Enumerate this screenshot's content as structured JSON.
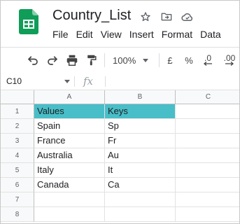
{
  "app": {
    "doc_title": "Country_List",
    "menu": [
      "File",
      "Edit",
      "View",
      "Insert",
      "Format",
      "Data"
    ]
  },
  "toolbar": {
    "zoom": "100%",
    "currency": "£",
    "percent": "%",
    "decrease_decimals": ".0",
    "increase_decimals": ".00"
  },
  "formula_bar": {
    "name_box": "C10",
    "fx_label": "fx",
    "value": ""
  },
  "grid": {
    "columns": [
      "A",
      "B",
      "C"
    ],
    "rows": [
      {
        "num": "1",
        "cells": [
          "Values",
          "Keys",
          ""
        ]
      },
      {
        "num": "2",
        "cells": [
          "Spain",
          "Sp",
          ""
        ]
      },
      {
        "num": "3",
        "cells": [
          "France",
          "Fr",
          ""
        ]
      },
      {
        "num": "4",
        "cells": [
          "Australia",
          "Au",
          ""
        ]
      },
      {
        "num": "5",
        "cells": [
          "Italy",
          "It",
          ""
        ]
      },
      {
        "num": "6",
        "cells": [
          "Canada",
          "Ca",
          ""
        ]
      },
      {
        "num": "7",
        "cells": [
          "",
          "",
          ""
        ]
      },
      {
        "num": "8",
        "cells": [
          "",
          "",
          ""
        ]
      }
    ],
    "header_fill": "#48bec8"
  },
  "colors": {
    "sheets_green": "#0f9d58",
    "gridline": "#e2e2e2"
  }
}
